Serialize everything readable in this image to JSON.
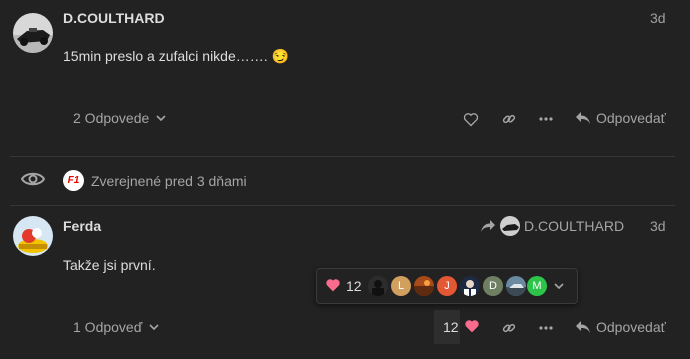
{
  "post1": {
    "username": "D.COULTHARD",
    "date": "3d",
    "text": "15min preslo a zufalci nikde……. ",
    "emoji": "😏",
    "replies_label": "2 Odpovede",
    "reply_label": "Odpovedať"
  },
  "event": {
    "badge": "F1",
    "text": "Zverejnené pred 3 dňami"
  },
  "post2": {
    "username": "Ferda",
    "reply_to": "D.COULTHARD",
    "date": "3d",
    "text": "Takže jsi první.",
    "replies_label": "1 Odpoveď",
    "like_count": "12",
    "reply_label": "Odpovedať"
  },
  "reactions": {
    "count": "12",
    "users": [
      "L",
      "J",
      "D",
      "M"
    ]
  },
  "colors": {
    "background": "#222222",
    "heart": "#fa6c8d",
    "text": "#dddddd",
    "muted": "#a5a5a5"
  }
}
